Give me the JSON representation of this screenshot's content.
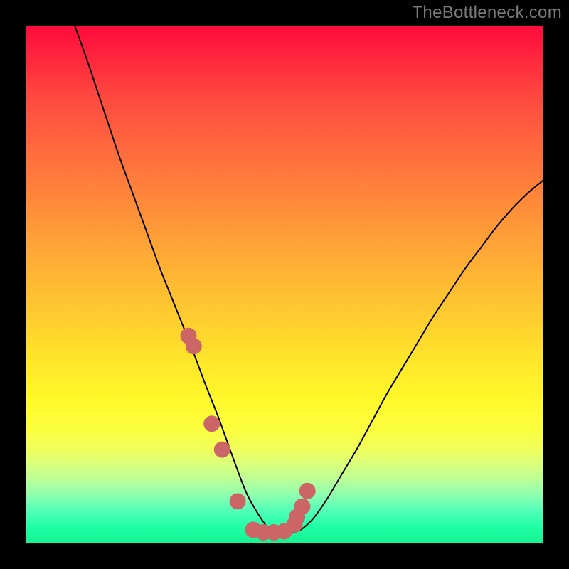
{
  "watermark": "TheBottleneck.com",
  "chart_data": {
    "type": "line",
    "title": "",
    "xlabel": "",
    "ylabel": "",
    "xlim": [
      0,
      100
    ],
    "ylim": [
      0,
      100
    ],
    "grid": false,
    "series": [
      {
        "name": "black-curve",
        "x": [
          9.5,
          12,
          14,
          16,
          18,
          20,
          22,
          24,
          26,
          28,
          30,
          32,
          33.5,
          35,
          37,
          39,
          41,
          43,
          46,
          48,
          52,
          55,
          58,
          61,
          64,
          67,
          70,
          73,
          76,
          79,
          82,
          85,
          88,
          91,
          94,
          97,
          100
        ],
        "values": [
          100,
          93,
          87,
          81,
          75,
          69.5,
          64,
          58.5,
          53,
          48,
          43,
          38,
          34,
          30,
          25,
          19.5,
          14,
          9,
          4,
          2,
          2,
          4,
          8,
          13,
          18,
          23.5,
          29,
          34,
          39,
          44,
          48.5,
          53,
          57,
          61,
          64.5,
          67.5,
          70
        ]
      },
      {
        "name": "highlight-markers",
        "x": [
          31.5,
          32.5,
          36,
          38,
          41,
          44,
          46,
          48,
          50,
          52,
          52.5,
          53.5,
          54.5
        ],
        "values": [
          40,
          38,
          23,
          18,
          8,
          2.5,
          2,
          2,
          2.2,
          3.5,
          5,
          7,
          10
        ]
      }
    ],
    "colors": {
      "curve": "#000000",
      "marker_fill": "#cc6666",
      "marker_stroke": "#b05858"
    },
    "background_gradient": [
      {
        "stop": 0.0,
        "color": "#ff0a3c"
      },
      {
        "stop": 0.33,
        "color": "#ff8939"
      },
      {
        "stop": 0.66,
        "color": "#ffe929"
      },
      {
        "stop": 0.85,
        "color": "#d8ff7d"
      },
      {
        "stop": 1.0,
        "color": "#16f48f"
      }
    ]
  }
}
